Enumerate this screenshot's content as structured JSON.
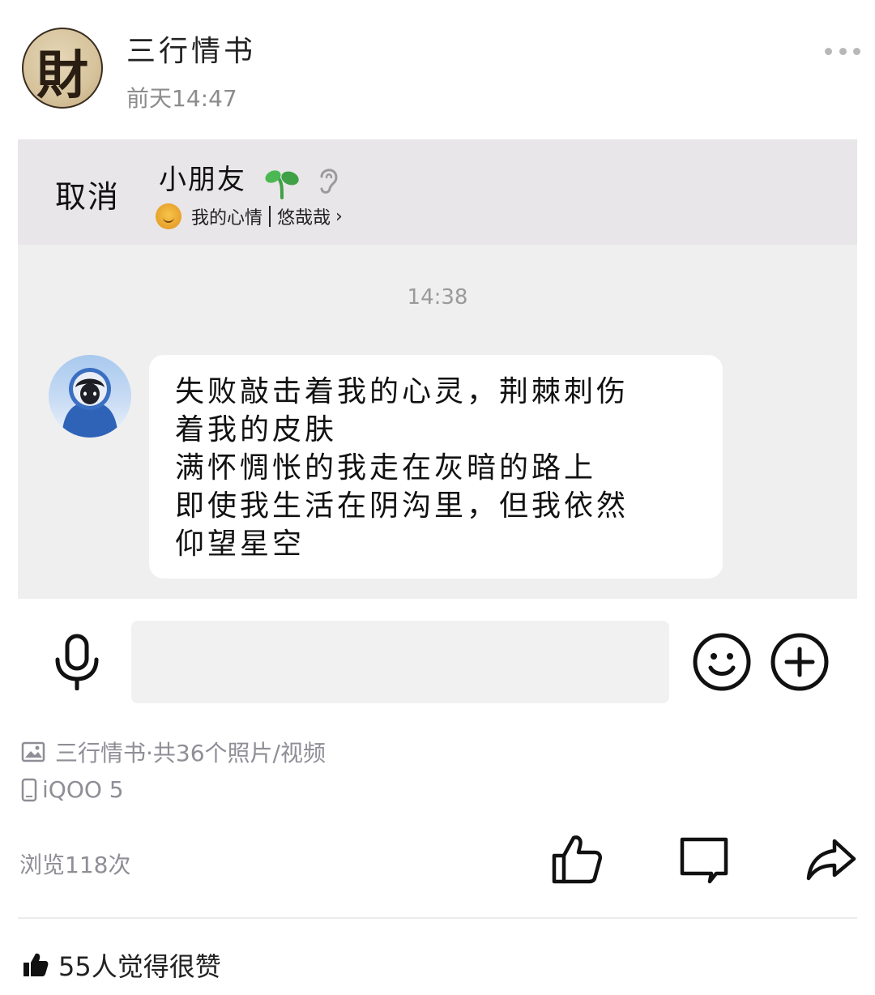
{
  "post": {
    "author_name": "三行情书",
    "avatar_glyph": "財",
    "time": "前天14:47"
  },
  "embedded_chat": {
    "cancel_label": "取消",
    "contact_name": "小朋友",
    "mood_label": "我的心情",
    "mood_value": "悠哉哉",
    "timestamp": "14:38",
    "message_lines": [
      "失败敲击着我的心灵，荆棘刺伤",
      "着我的皮肤",
      "满怀惆怅的我走在灰暗的路上",
      "即使我生活在阴沟里，但我依然",
      "仰望星空"
    ]
  },
  "composer": {
    "input_value": ""
  },
  "meta": {
    "album": "三行情书·共36个照片/视频",
    "device": "iQOO 5"
  },
  "stats": {
    "views": "浏览118次",
    "likes": "55人觉得很赞"
  },
  "icons": {
    "more": "more-icon",
    "mic": "microphone-icon",
    "emoji": "smiley-icon",
    "plus": "plus-icon",
    "photo": "photo-icon",
    "phone": "phone-icon",
    "like": "thumbs-up-icon",
    "comment": "comment-icon",
    "share": "share-icon"
  }
}
